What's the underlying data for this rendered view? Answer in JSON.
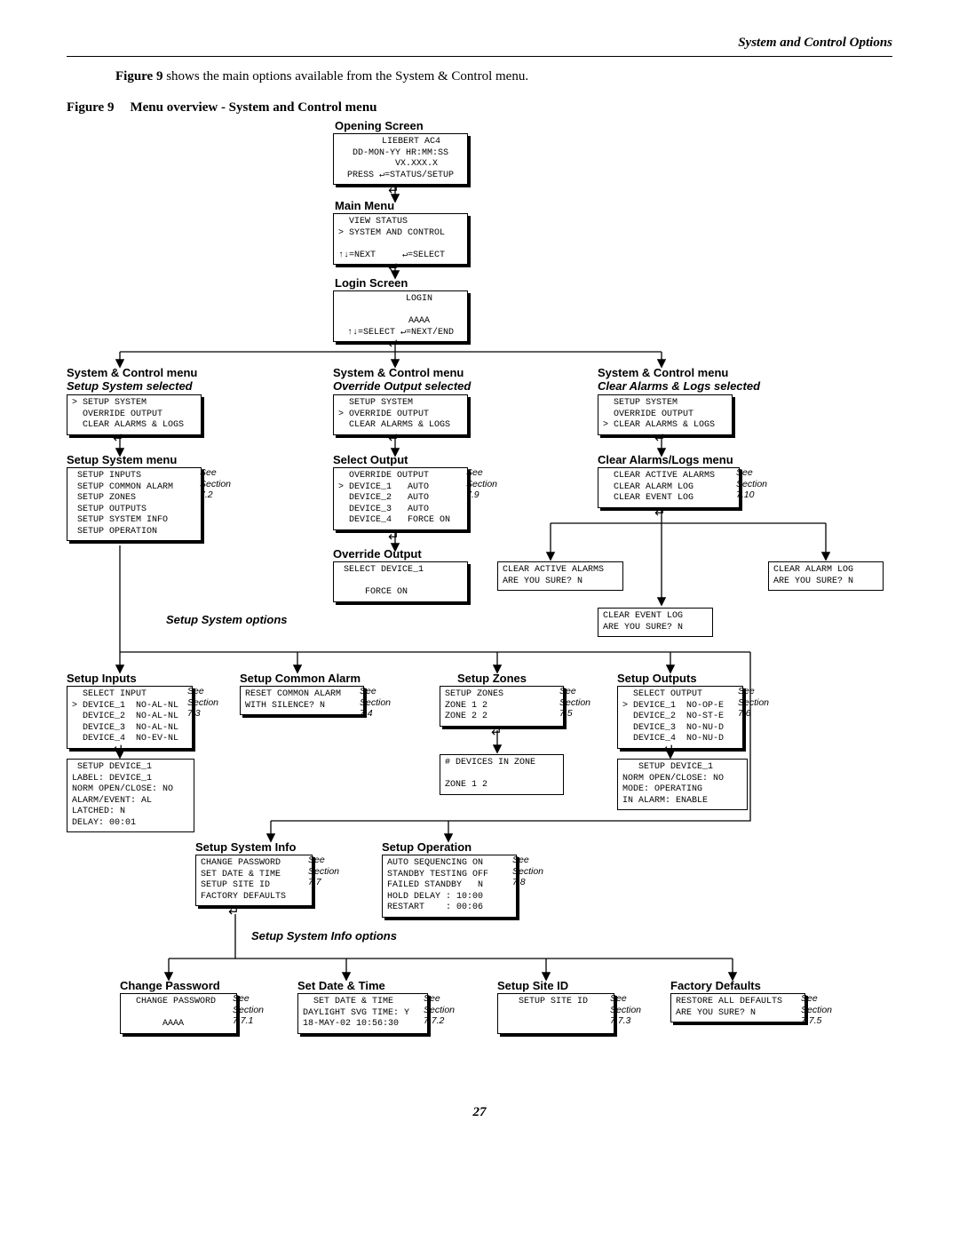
{
  "header": "System and Control Options",
  "intro_prefix": "Figure 9",
  "intro_text": " shows the main options available from the System & Control menu.",
  "fig_no": "Figure 9",
  "fig_title": "Menu overview - System and Control menu",
  "label": {
    "opening": "Opening Screen",
    "mainmenu": "Main Menu",
    "login": "Login Screen",
    "sc_menu": "System & Control menu",
    "setup_sel": "Setup System selected",
    "override_sel": "Override Output selected",
    "clear_sel": "Clear Alarms & Logs selected",
    "setup_menu": "Setup System menu",
    "select_output": "Select Output",
    "clear_menu": "Clear Alarms/Logs menu",
    "override_output": "Override Output",
    "setup_opts": "Setup System options",
    "setup_inputs": "Setup Inputs",
    "setup_common": "Setup Common Alarm",
    "setup_zones": "Setup Zones",
    "setup_outputs": "Setup Outputs",
    "setup_sysinfo": "Setup System Info",
    "setup_oper": "Setup Operation",
    "sysinfo_opts": "Setup System Info options",
    "change_pw": "Change Password",
    "setdt": "Set Date & Time",
    "siteid": "Setup Site ID",
    "factory": "Factory Defaults"
  },
  "see": {
    "s72": "See\nSection\n7.2",
    "s79": "See\nSection\n7.9",
    "s710": "See\nSection\n7.10",
    "s73": "See\nSection\n7.3",
    "s74": "See\nSection\n7.4",
    "s75": "See\nSection\n7.5",
    "s76": "See\nSection\n7.6",
    "s77": "See\nSection\n7.7",
    "s78": "See\nSection\n7.8",
    "s771": "See\nSection\n7.7.1",
    "s772": "See\nSection\n7.7.2",
    "s773": "See\nSection\n7.7.3",
    "s775": "See\nSection\n7.7.5"
  },
  "box": {
    "opening": "    LIEBERT AC4\nDD-MON-YY HR:MM:SS\n      VX.XXX.X\nPRESS ↵=STATUS/SETUP",
    "mainmenu": "  VIEW STATUS\n> SYSTEM AND CONTROL\n\n↑↓=NEXT     ↵=SELECT",
    "login": "       LOGIN\n\n       AAAA\n↑↓=SELECT ↵=NEXT/END",
    "sc_setup": "> SETUP SYSTEM\n  OVERRIDE OUTPUT\n  CLEAR ALARMS & LOGS",
    "sc_override": "  SETUP SYSTEM\n> OVERRIDE OUTPUT\n  CLEAR ALARMS & LOGS",
    "sc_clear": "  SETUP SYSTEM\n  OVERRIDE OUTPUT\n> CLEAR ALARMS & LOGS",
    "setup_menu": " SETUP INPUTS\n SETUP COMMON ALARM\n SETUP ZONES\n SETUP OUTPUTS\n SETUP SYSTEM INFO\n SETUP OPERATION",
    "select_output": "  OVERRIDE OUTPUT\n> DEVICE_1   AUTO\n  DEVICE_2   AUTO\n  DEVICE_3   AUTO\n  DEVICE_4   FORCE ON",
    "clear_menu": "  CLEAR ACTIVE ALARMS\n  CLEAR ALARM LOG\n  CLEAR EVENT LOG",
    "override_out": " SELECT DEVICE_1\n\n     FORCE ON",
    "clear_active": "CLEAR ACTIVE ALARMS\nARE YOU SURE? N",
    "clear_alarm": "CLEAR ALARM LOG\nARE YOU SURE? N",
    "clear_event": "CLEAR EVENT LOG\nARE YOU SURE? N",
    "setup_inputs": "  SELECT INPUT\n> DEVICE_1  NO-AL-NL\n  DEVICE_2  NO-AL-NL\n  DEVICE_3  NO-AL-NL\n  DEVICE_4  NO-EV-NL",
    "setup_dev1": " SETUP DEVICE_1\nLABEL: DEVICE_1\nNORM OPEN/CLOSE: NO\nALARM/EVENT: AL\nLATCHED: N\nDELAY: 00:01",
    "setup_common": "RESET COMMON ALARM\nWITH SILENCE? N",
    "setup_zones": "SETUP ZONES\nZONE 1 2\nZONE 2 2",
    "zones_dev": "# DEVICES IN ZONE\n\nZONE 1 2",
    "setup_outputs": "  SELECT OUTPUT\n> DEVICE_1  NO-OP-E\n  DEVICE_2  NO-ST-E\n  DEVICE_3  NO-NU-D\n  DEVICE_4  NO-NU-D",
    "setup_outdev": "   SETUP DEVICE_1\nNORM OPEN/CLOSE: NO\nMODE: OPERATING\nIN ALARM: ENABLE",
    "setup_sysinfo": "CHANGE PASSWORD\nSET DATE & TIME\nSETUP SITE ID\nFACTORY DEFAULTS",
    "setup_oper": "AUTO SEQUENCING ON\nSTANDBY TESTING OFF\nFAILED STANDBY   N\nHOLD DELAY : 10:00\nRESTART    : 00:06",
    "change_pw": "  CHANGE PASSWORD\n\n       AAAA",
    "setdt": "  SET DATE & TIME\nDAYLIGHT SVG TIME: Y\n18-MAY-02 10:56:30",
    "siteid": "   SETUP SITE ID\n\n",
    "factory": "RESTORE ALL DEFAULTS\nARE YOU SURE? N"
  },
  "enter": "↵",
  "pageno": "27"
}
